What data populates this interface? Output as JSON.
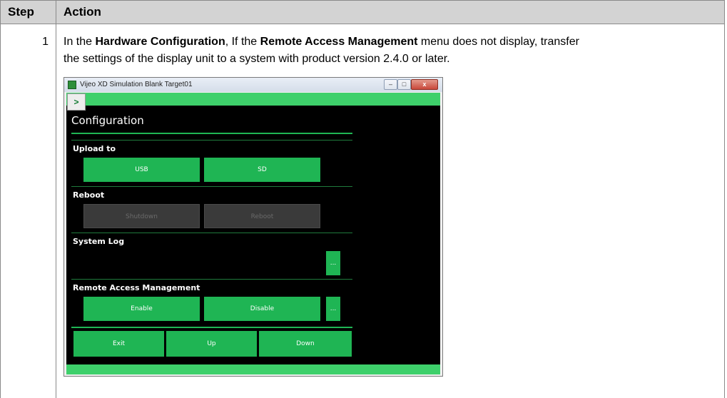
{
  "table": {
    "header_step": "Step",
    "header_action": "Action"
  },
  "row": {
    "step": "1",
    "text_prefix": "In the ",
    "bold1": "Hardware Configuration",
    "text_mid": ", If the ",
    "bold2": "Remote Access Management",
    "text_line1_end": " menu does not display, transfer",
    "text_line2": "the settings of the display unit to a system with product version 2.4.0 or later."
  },
  "window": {
    "title": "Vijeo XD Simulation Blank Target01",
    "min_glyph": "–",
    "max_glyph": "□",
    "close_glyph": "x",
    "nav_glyph": ">"
  },
  "app": {
    "title": "Configuration",
    "upload_label": "Upload to",
    "usb_button": "USB",
    "sd_button": "SD",
    "reboot_label": "Reboot",
    "shutdown_button": "Shutdown",
    "reboot_button": "Reboot",
    "syslog_label": "System Log",
    "syslog_more": "...",
    "remote_label": "Remote Access Management",
    "enable_button": "Enable",
    "disable_button": "Disable",
    "remote_more": "...",
    "exit_button": "Exit",
    "up_button": "Up",
    "down_button": "Down"
  },
  "colors": {
    "accent_green": "#1fb554",
    "bar_green": "#3ed06b",
    "app_background": "#000000",
    "table_header": "#d3d3d3"
  }
}
